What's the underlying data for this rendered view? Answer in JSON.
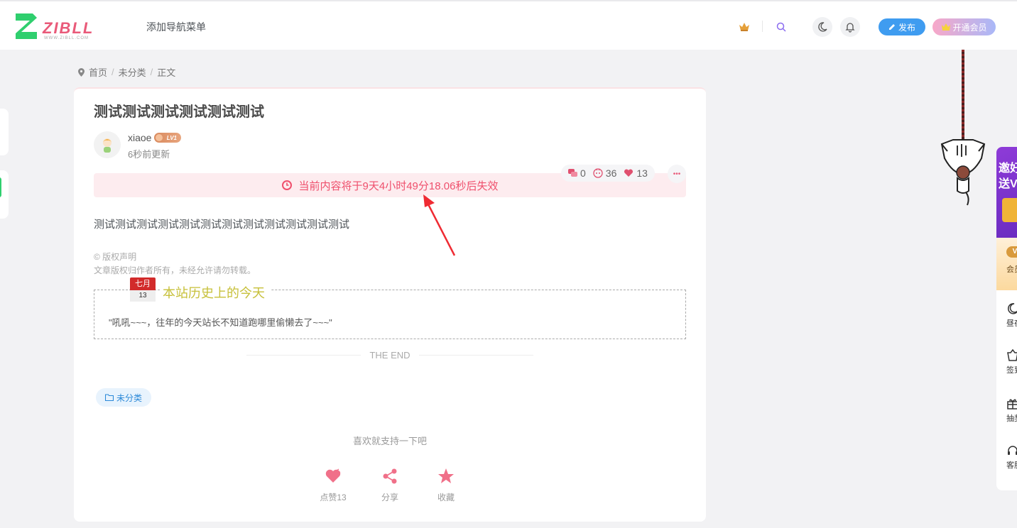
{
  "header": {
    "logo_text": "ZIBLL",
    "logo_sub": "WWW.ZIBLL.COM",
    "nav_item": "添加导航菜单",
    "publish_label": "发布",
    "vip_label": "开通会员"
  },
  "breadcrumb": {
    "home": "首页",
    "category": "未分类",
    "current": "正文",
    "separator": "/"
  },
  "post": {
    "title": "测试测试测试测试测试测试",
    "author": "xiaoe",
    "level": "LV1",
    "updated": "6秒前更新",
    "stats": {
      "comments": "0",
      "views": "36",
      "likes": "13"
    },
    "expire_notice": "当前内容将于9天4小时49分18.06秒后失效",
    "body": "测试测试测试测试测试测试测试测试测试测试测试测试",
    "copyright_title": "© 版权声明",
    "copyright_text": "文章版权归作者所有，未经允许请勿转载。",
    "history": {
      "month": "七月",
      "day": "13",
      "title": "本站历史上的今天",
      "text": "\"吼吼~~~，往年的今天站长不知道跑哪里偷懒去了~~~\""
    },
    "the_end": "THE END",
    "tag": "未分类",
    "support_text": "喜欢就支持一下吧",
    "actions": {
      "like": "点赞13",
      "share": "分享",
      "favorite": "收藏"
    }
  },
  "right_panel": {
    "banner_line1": "邀好",
    "banner_line2": "送V",
    "vip_badge": "V",
    "vip_label": "会员",
    "items": [
      "昼夜",
      "签到",
      "抽奖",
      "客服"
    ]
  },
  "colors": {
    "accent_pink": "#ef4f6c",
    "publish_blue": "#3f9cf0",
    "tag_blue": "#2a88d8",
    "history_title": "#c7c03a",
    "logo_green": "#2fcf6e"
  }
}
